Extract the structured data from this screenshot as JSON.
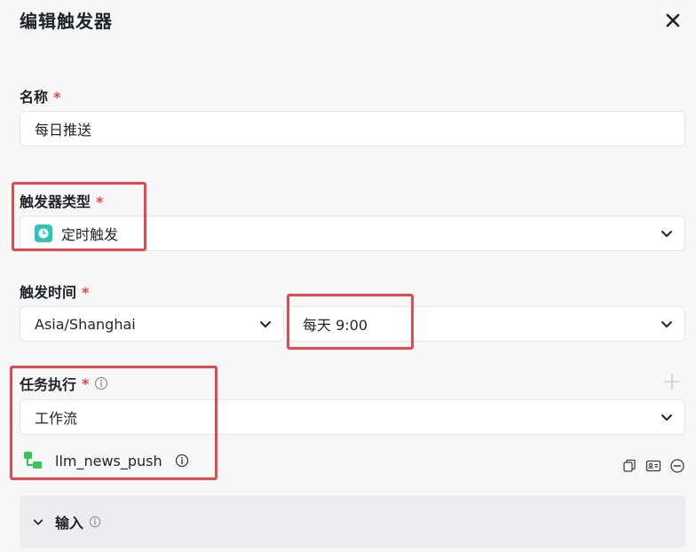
{
  "dialog": {
    "title": "编辑触发器"
  },
  "name": {
    "label": "名称",
    "required": "*",
    "value": "每日推送"
  },
  "trigger_type": {
    "label": "触发器类型",
    "required": "*",
    "value": "定时触发",
    "icon": "clock-icon"
  },
  "trigger_time": {
    "label": "触发时间",
    "required": "*",
    "timezone": "Asia/Shanghai",
    "schedule": "每天 9:00"
  },
  "task": {
    "label": "任务执行",
    "required": "*",
    "type": "工作流",
    "workflow_name": "llm_news_push"
  },
  "input_section": {
    "label": "输入"
  },
  "colors": {
    "required": "#f53f3f",
    "highlight": "#e5484d",
    "clock_icon": "#2ec4b6",
    "workflow_icon": "#34c759"
  }
}
